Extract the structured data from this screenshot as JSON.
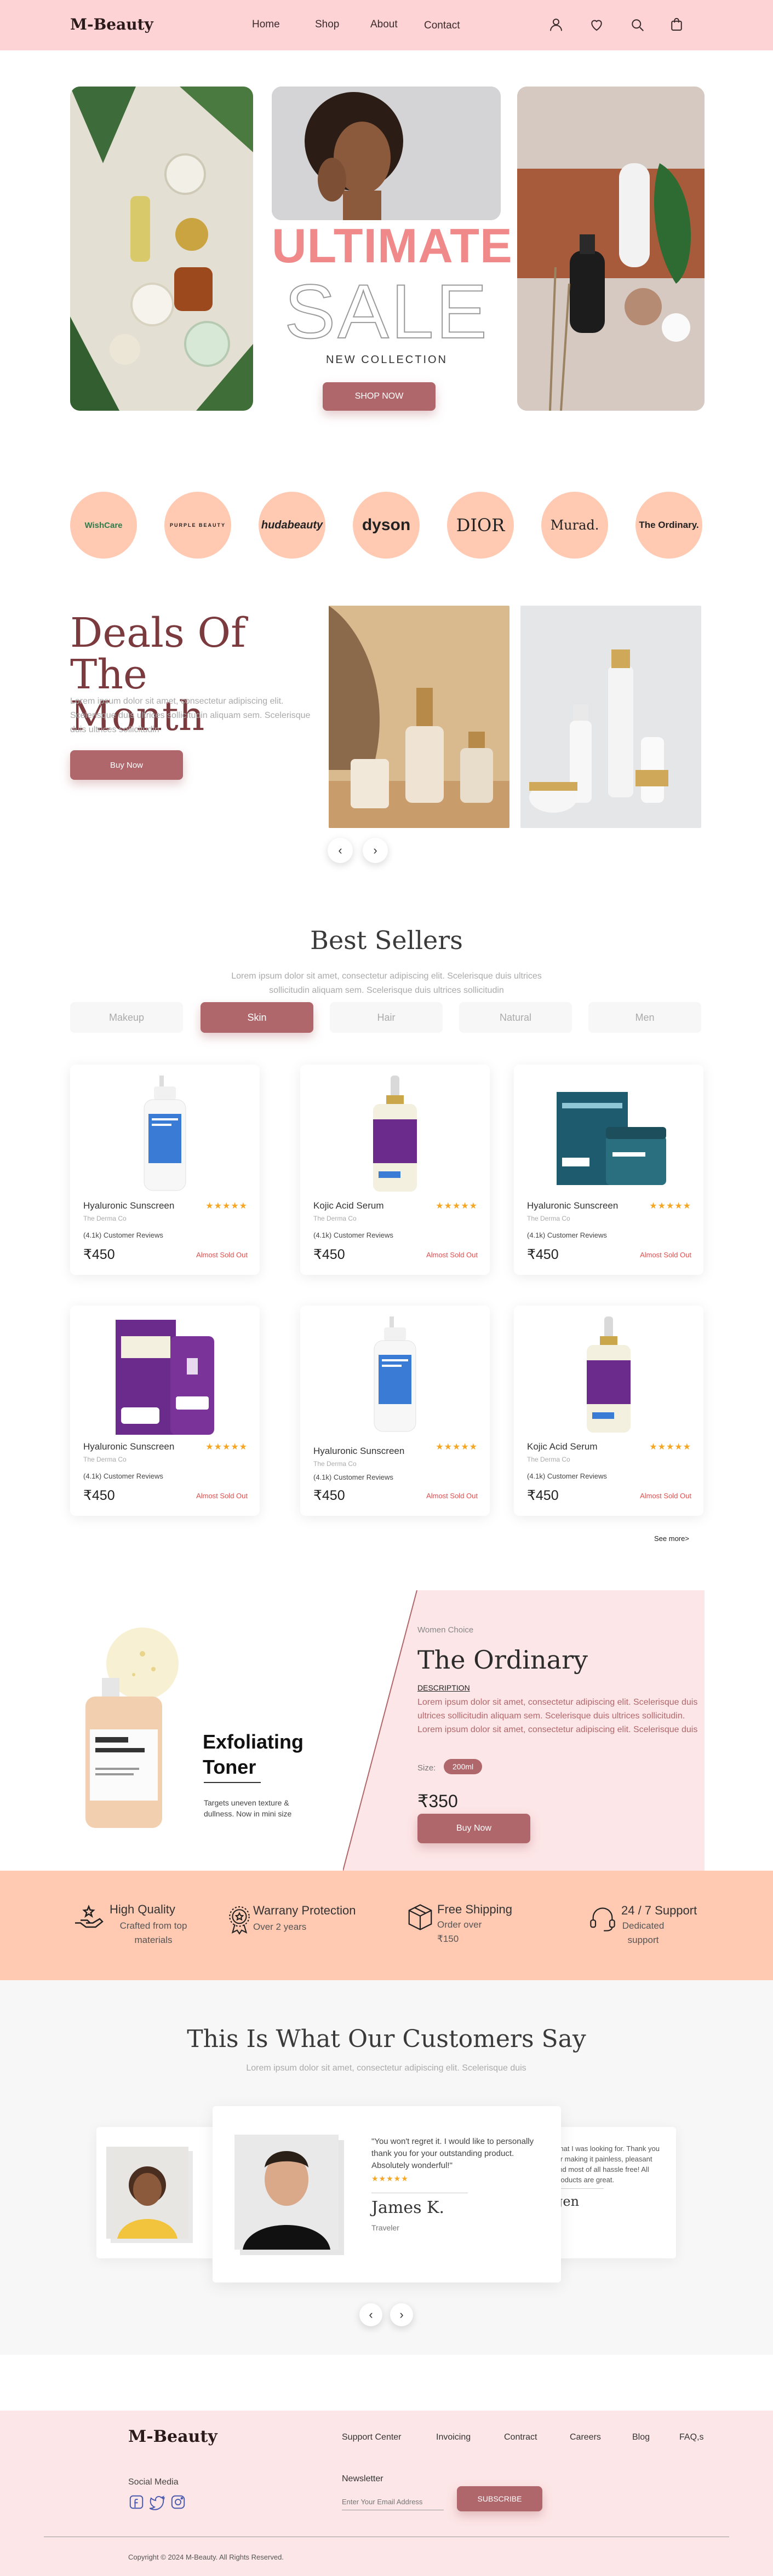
{
  "header": {
    "logo": "M-Beauty",
    "nav": [
      "Home",
      "Shop",
      "About",
      "Contact"
    ],
    "icons": [
      "user-icon",
      "heart-icon",
      "search-icon",
      "bag-icon"
    ]
  },
  "hero": {
    "headline": "ULTIMATE",
    "sale": "SALE",
    "subtitle": "NEW COLLECTION",
    "cta": "SHOP NOW"
  },
  "brands": [
    "WishCare",
    "PURPLE BEAUTY",
    "hudabeauty",
    "dyson",
    "DIOR",
    "Murad.",
    "The Ordinary."
  ],
  "deals": {
    "title_line1": "Deals Of The",
    "title_line2": "Month",
    "text": "Lorem ipsum dolor sit amet, consectetur adipiscing elit. Scelerisque duis ultrices sollicitudin aliquam sem. Scelerisque duis ultrices sollicitudin",
    "cta": "Buy Now",
    "prev": "‹",
    "next": "›"
  },
  "best_sellers": {
    "title": "Best Sellers",
    "subtitle": "Lorem ipsum dolor sit amet, consectetur adipiscing elit. Scelerisque duis ultrices sollicitudin aliquam sem. Scelerisque duis ultrices sollicitudin",
    "tabs": [
      "Makeup",
      "Skin",
      "Hair",
      "Natural",
      "Men"
    ],
    "active_tab": "Skin",
    "products": [
      {
        "name": "Hyaluronic Sunscreen",
        "brand": "The Derma Co",
        "reviews": "(4.1k) Customer Reviews",
        "price": "₹450",
        "status": "Almost Sold Out",
        "stars": "★★★★★"
      },
      {
        "name": "Kojic Acid Serum",
        "brand": "The Derma Co",
        "reviews": "(4.1k) Customer Reviews",
        "price": "₹450",
        "status": "Almost Sold Out",
        "stars": "★★★★★"
      },
      {
        "name": "Hyaluronic Sunscreen",
        "brand": "The Derma Co",
        "reviews": "(4.1k) Customer Reviews",
        "price": "₹450",
        "status": "Almost Sold Out",
        "stars": "★★★★★"
      },
      {
        "name": "Hyaluronic Sunscreen",
        "brand": "The Derma Co",
        "reviews": "(4.1k) Customer Reviews",
        "price": "₹450",
        "status": "Almost Sold Out",
        "stars": "★★★★★"
      },
      {
        "name": "Hyaluronic Sunscreen",
        "brand": "The Derma Co",
        "reviews": "(4.1k) Customer Reviews",
        "price": "₹450",
        "status": "Almost Sold Out",
        "stars": "★★★★★"
      },
      {
        "name": "Kojic Acid Serum",
        "brand": "The Derma Co",
        "reviews": "(4.1k) Customer Reviews",
        "price": "₹450",
        "status": "Almost Sold Out",
        "stars": "★★★★★"
      }
    ],
    "see_more": "See more>"
  },
  "promo": {
    "product_title_line1": "Exfoliating",
    "product_title_line2": "Toner",
    "product_desc": "Targets uneven texture & dullness. Now in mini size",
    "label": "Women Choice",
    "brand": "The Ordinary",
    "desc_heading": "DESCRIPTION",
    "desc": "Lorem ipsum dolor sit amet, consectetur adipiscing elit. Scelerisque duis ultrices sollicitudin aliquam sem. Scelerisque duis ultrices sollicitudin. Lorem ipsum dolor sit amet, consectetur adipiscing elit. Scelerisque duis",
    "size_label": "Size:",
    "size_value": "200ml",
    "price": "₹350",
    "cta": "Buy Now"
  },
  "features": [
    {
      "title": "High Quality",
      "sub1": "Crafted from top",
      "sub2": "materials"
    },
    {
      "title": "Warrany Protection",
      "sub1": "Over 2 years",
      "sub2": ""
    },
    {
      "title": "Free Shipping",
      "sub1": "Order over",
      "sub2": "₹150"
    },
    {
      "title": "24 / 7 Support",
      "sub1": "Dedicated",
      "sub2": "support"
    }
  ],
  "testimonials": {
    "title": "This Is What Our Customers Say",
    "subtitle": "Lorem ipsum dolor sit amet, consectetur adipiscing elit. Scelerisque duis",
    "main": {
      "quote": "\"You won't regret it. I would like to personally thank you for your outstanding product. Absolutely wonderful!\"",
      "stars": "★★★★★",
      "name": "James K.",
      "role": "Traveler"
    },
    "side_quote": "what I was looking for. Thank you for making it painless, pleasant and most of all hassle free! All products are great.",
    "side_name": "gen",
    "prev": "‹",
    "next": "›"
  },
  "footer": {
    "logo": "M-Beauty",
    "links": [
      "Support Center",
      "Invoicing",
      "Contract",
      "Careers",
      "Blog",
      "FAQ,s"
    ],
    "social_label": "Social Media",
    "newsletter_label": "Newsletter",
    "email_placeholder": "Enter Your Email Address",
    "subscribe": "SUBSCRIBE",
    "copyright": "Copyright © 2024 M-Beauty. All Rights Reserved."
  },
  "colors": {
    "header_bg": "#fdd3d6",
    "accent": "#b0676b",
    "brand_circle": "#ffc9b2",
    "promo_bg": "#fde6e7",
    "sale_pink": "#f08a8a",
    "stars": "#f5a623",
    "sold_out": "#e24d4d"
  }
}
